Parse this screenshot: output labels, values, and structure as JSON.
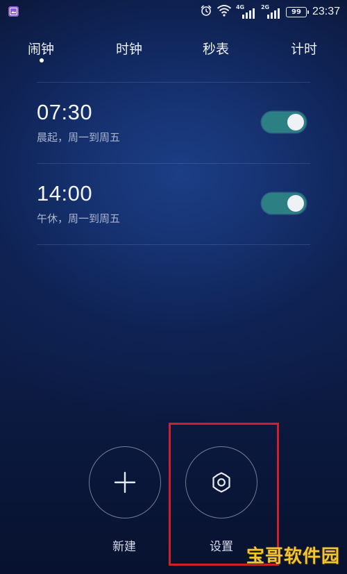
{
  "status_bar": {
    "network_1": "4G",
    "network_2": "2G",
    "battery": "99",
    "time": "23:37"
  },
  "tabs": [
    {
      "label": "闹钟",
      "active": true
    },
    {
      "label": "时钟",
      "active": false
    },
    {
      "label": "秒表",
      "active": false
    },
    {
      "label": "计时",
      "active": false
    }
  ],
  "alarms": [
    {
      "time": "07:30",
      "description": "晨起，周一到周五",
      "enabled": true
    },
    {
      "time": "14:00",
      "description": "午休，周一到周五",
      "enabled": true
    }
  ],
  "actions": {
    "new_label": "新建",
    "settings_label": "设置"
  },
  "watermark": "宝哥软件园",
  "colors": {
    "toggle_on": "#2c7f82",
    "highlight": "#d2202a",
    "watermark": "#f3c534"
  }
}
